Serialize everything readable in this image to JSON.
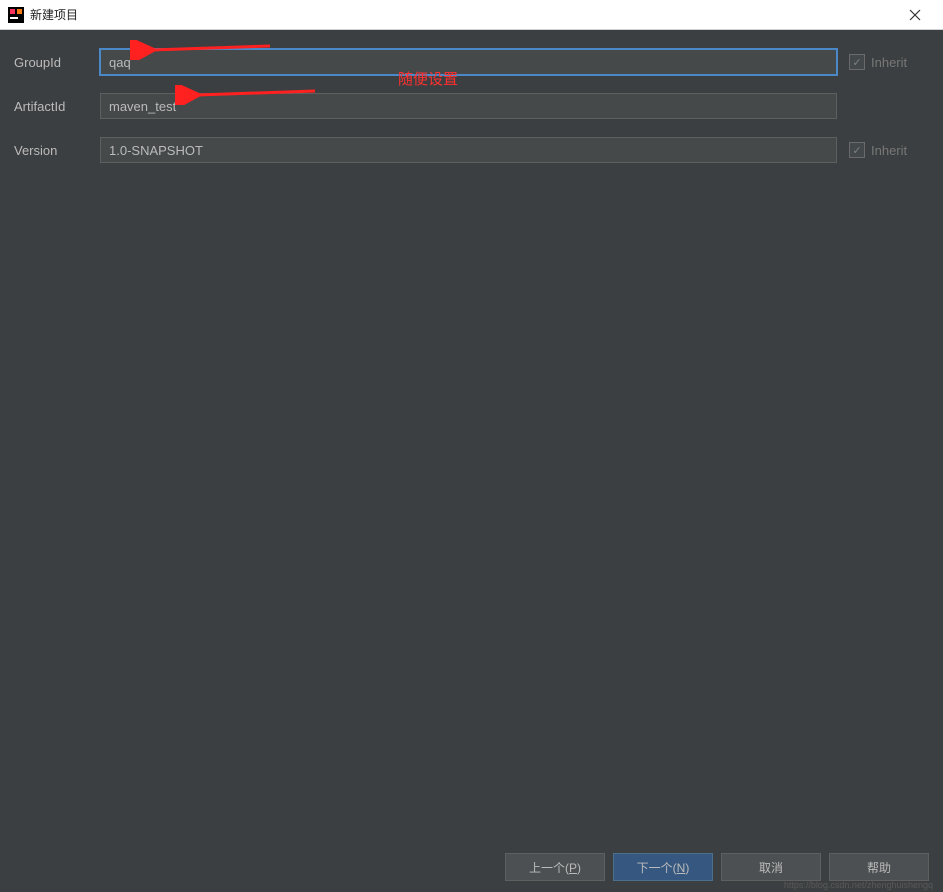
{
  "window": {
    "title": "新建项目"
  },
  "form": {
    "groupId": {
      "label": "GroupId",
      "value": "qaq",
      "inherit_label": "Inherit",
      "inherit_checked": true
    },
    "artifactId": {
      "label": "ArtifactId",
      "value": "maven_test"
    },
    "version": {
      "label": "Version",
      "value": "1.0-SNAPSHOT",
      "inherit_label": "Inherit",
      "inherit_checked": true
    }
  },
  "annotation": {
    "text": "随便设置"
  },
  "buttons": {
    "previous": "上一个(P)",
    "previous_mnemonic": "P",
    "next": "下一个(N)",
    "next_mnemonic": "N",
    "cancel": "取消",
    "help": "帮助"
  },
  "watermark": "https://blog.csdn.net/zhenghuishengq"
}
